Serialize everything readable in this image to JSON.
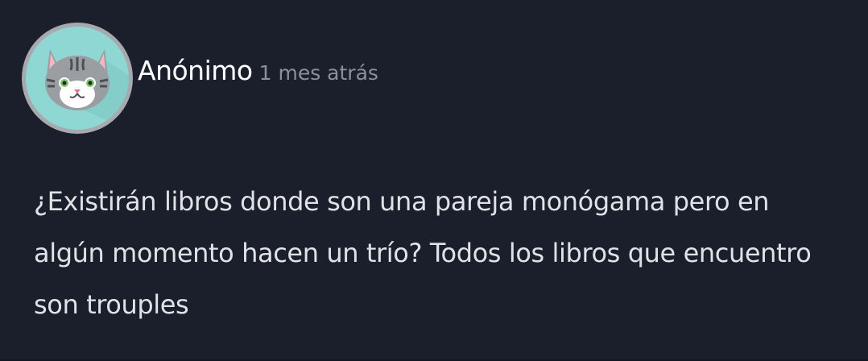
{
  "post": {
    "author": "Anónimo",
    "time": "1 mes atrás",
    "avatar_icon": "cat-avatar-icon",
    "text": "¿Existirán libros donde son una pareja monógama pero en algún momento hacen un trío? Todos los libros que encuentro son trouples"
  },
  "colors": {
    "background": "#1a1f2b",
    "author": "#ffffff",
    "time": "#8a919c",
    "body": "#dfe2e6",
    "avatar_bg": "#8fd7d2",
    "avatar_ring": "#a6a9ad"
  }
}
